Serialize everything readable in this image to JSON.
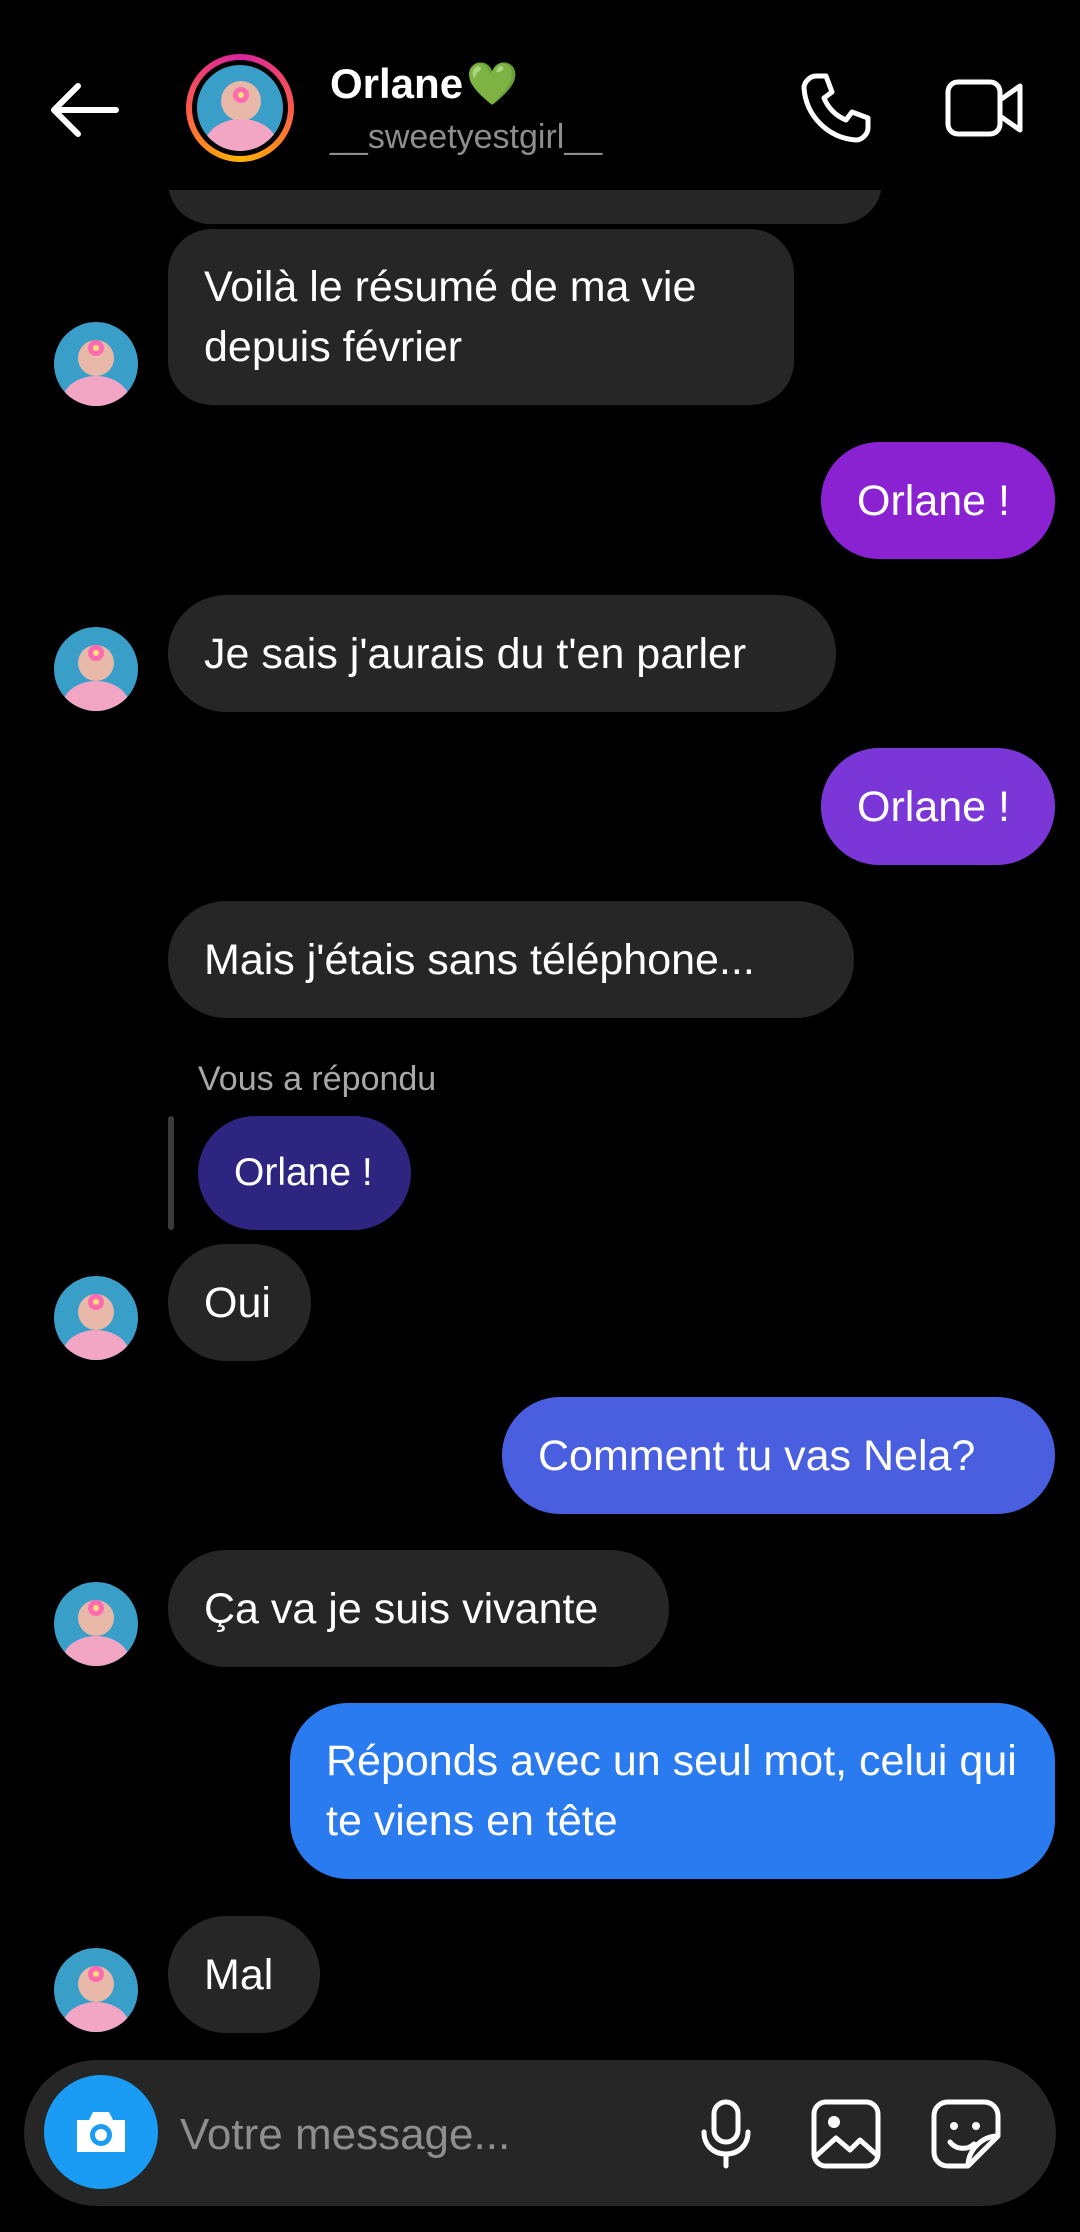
{
  "header": {
    "name": "Orlane",
    "heart": "💚",
    "username": "__sweetyestgirl__"
  },
  "colors": {
    "incoming": "#262626",
    "outgoing_purple": "#8a22d2",
    "outgoing_violet": "#7b36d8",
    "reply_quote": "#2e2580",
    "outgoing_indigo": "#4a5fe0",
    "outgoing_blue": "#2a7af0",
    "camera": "#1a9cf4"
  },
  "messages": [
    {
      "text": "Voilà le résumé de ma vie\ndepuis février",
      "dir": "in"
    },
    {
      "text": "Orlane !",
      "dir": "out"
    },
    {
      "text": "Je sais j'aurais du t'en parler",
      "dir": "in"
    },
    {
      "text": "Orlane !",
      "dir": "out"
    },
    {
      "text": "Mais j'étais sans téléphone...",
      "dir": "in"
    },
    {
      "text": "Oui",
      "dir": "in"
    },
    {
      "text": "Comment tu vas Nela?",
      "dir": "out"
    },
    {
      "text": "Ça va je suis vivante",
      "dir": "in"
    },
    {
      "text": "Réponds avec un seul mot, celui qui te viens en tête",
      "dir": "out"
    },
    {
      "text": "Mal",
      "dir": "in"
    }
  ],
  "reply": {
    "label": "Vous a répondu",
    "quoted": "Orlane !"
  },
  "composer": {
    "placeholder": "Votre message..."
  }
}
